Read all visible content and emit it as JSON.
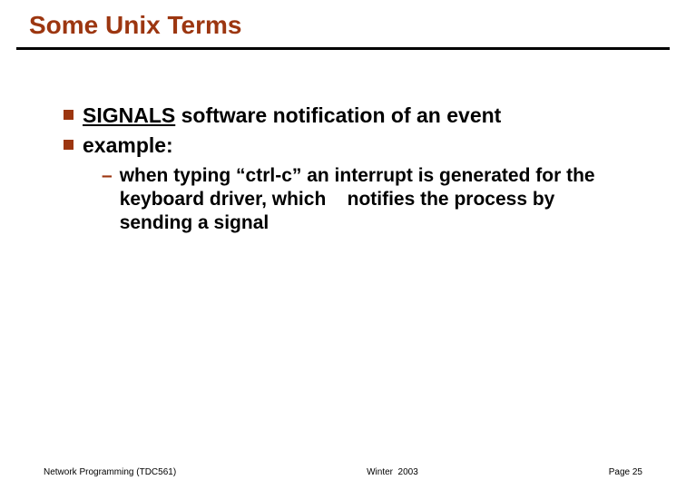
{
  "slide": {
    "title": "Some Unix Terms",
    "bullets": [
      {
        "term": "SIGNALS",
        "rest": " software notification of an event"
      },
      {
        "term": "",
        "rest": "example:"
      }
    ],
    "sub": {
      "dash": "–",
      "text": "when typing “ctrl-c” an interrupt is generated for the keyboard driver, which    notifies the process by sending a signal"
    }
  },
  "footer": {
    "left": "Network Programming (TDC561)",
    "center": "Winter  2003",
    "right": "Page 25"
  }
}
